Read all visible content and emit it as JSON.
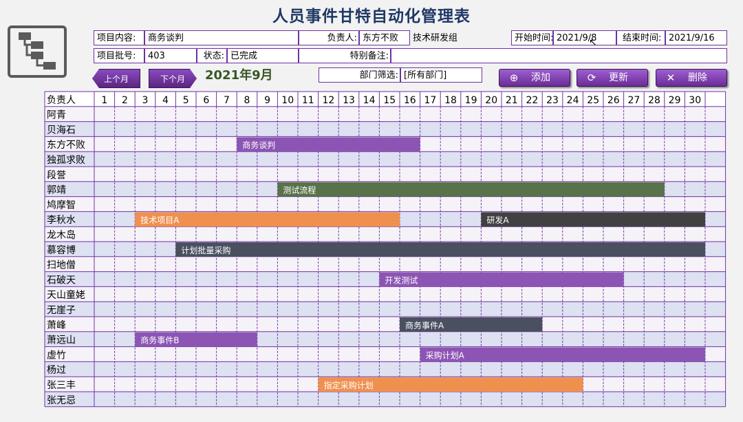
{
  "title": "人员事件甘特自动化管理表",
  "header": {
    "project_content_label": "项目内容:",
    "project_content_value": "商务谈判",
    "owner_label": "负责人:",
    "owner_value": "东方不败",
    "dept_value": "技术研发组",
    "start_label": "开始时间:",
    "start_value": "2021/9/8",
    "end_label": "结束时间:",
    "end_value": "2021/9/16",
    "batch_label": "项目批号:",
    "batch_value": "403",
    "status_label": "状态:",
    "status_value": "已完成",
    "note_label": "特别备注:",
    "note_value": ""
  },
  "nav": {
    "prev_label": "上个月",
    "next_label": "下个月",
    "month_label": "2021年9月"
  },
  "filter": {
    "label": "部门筛选:",
    "value": "[所有部门]"
  },
  "buttons": {
    "add": "添加",
    "update": "更新",
    "delete": "删除"
  },
  "grid": {
    "header_label": "负责人",
    "days": [
      "1",
      "2",
      "3",
      "4",
      "5",
      "6",
      "7",
      "8",
      "9",
      "10",
      "11",
      "12",
      "13",
      "14",
      "15",
      "16",
      "17",
      "18",
      "19",
      "20",
      "21",
      "22",
      "23",
      "24",
      "25",
      "26",
      "27",
      "28",
      "29",
      "30",
      ""
    ],
    "people": [
      "阿青",
      "贝海石",
      "东方不败",
      "独孤求败",
      "段誉",
      "郭靖",
      "鸠摩智",
      "李秋水",
      "龙木岛",
      "慕容博",
      "扫地僧",
      "石破天",
      "天山童姥",
      "无崖子",
      "萧峰",
      "萧远山",
      "虚竹",
      "杨过",
      "张三丰",
      "张无忌"
    ]
  },
  "colors": {
    "purple": "#8c55b4",
    "green": "#58724a",
    "orange": "#f0904f",
    "dark": "#414141",
    "slate": "#4a5060"
  },
  "chart_data": {
    "type": "gantt",
    "tasks": [
      {
        "row": 2,
        "start": 8,
        "end": 16,
        "label": "商务谈判",
        "color": "#8c55b4"
      },
      {
        "row": 5,
        "start": 10,
        "end": 28,
        "label": "测试流程",
        "color": "#58724a"
      },
      {
        "row": 7,
        "start": 3,
        "end": 15,
        "label": "技术项目A",
        "color": "#f0904f"
      },
      {
        "row": 7,
        "start": 20,
        "end": 30,
        "label": "研发A",
        "color": "#414141"
      },
      {
        "row": 9,
        "start": 5,
        "end": 30,
        "label": "计划批量采购",
        "color": "#4a5060"
      },
      {
        "row": 11,
        "start": 15,
        "end": 26,
        "label": "开发测试",
        "color": "#8c55b4"
      },
      {
        "row": 14,
        "start": 16,
        "end": 22,
        "label": "商务事件A",
        "color": "#4a5060"
      },
      {
        "row": 15,
        "start": 3,
        "end": 8,
        "label": "商务事件B",
        "color": "#8c55b4"
      },
      {
        "row": 16,
        "start": 17,
        "end": 30,
        "label": "采购计划A",
        "color": "#8c55b4"
      },
      {
        "row": 18,
        "start": 12,
        "end": 24,
        "label": "指定采购计划",
        "color": "#f0904f"
      }
    ]
  }
}
